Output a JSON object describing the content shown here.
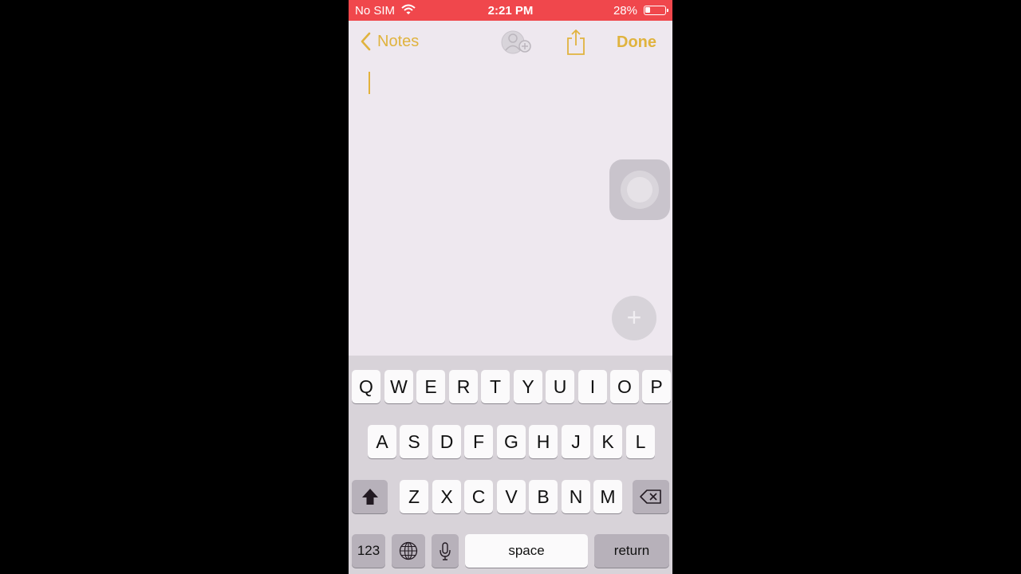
{
  "status": {
    "carrier": "No SIM",
    "time": "2:21 PM",
    "battery_percent": "28%",
    "battery_level": 0.28
  },
  "nav": {
    "back_label": "Notes",
    "done_label": "Done",
    "accent_color": "#e0b33e"
  },
  "icons": {
    "wifi": "wifi-icon",
    "battery": "battery-icon",
    "back": "chevron-left-icon",
    "collaborate": "add-person-icon",
    "share": "share-icon",
    "add": "plus-icon",
    "shift": "shift-icon",
    "delete": "backspace-icon",
    "globe": "globe-icon",
    "mic": "microphone-icon"
  },
  "add_button_label": "+",
  "keyboard": {
    "row1": [
      "Q",
      "W",
      "E",
      "R",
      "T",
      "Y",
      "U",
      "I",
      "O",
      "P"
    ],
    "row2": [
      "A",
      "S",
      "D",
      "F",
      "G",
      "H",
      "J",
      "K",
      "L"
    ],
    "row3": [
      "Z",
      "X",
      "C",
      "V",
      "B",
      "N",
      "M"
    ],
    "numbers_label": "123",
    "space_label": "space",
    "return_label": "return"
  }
}
